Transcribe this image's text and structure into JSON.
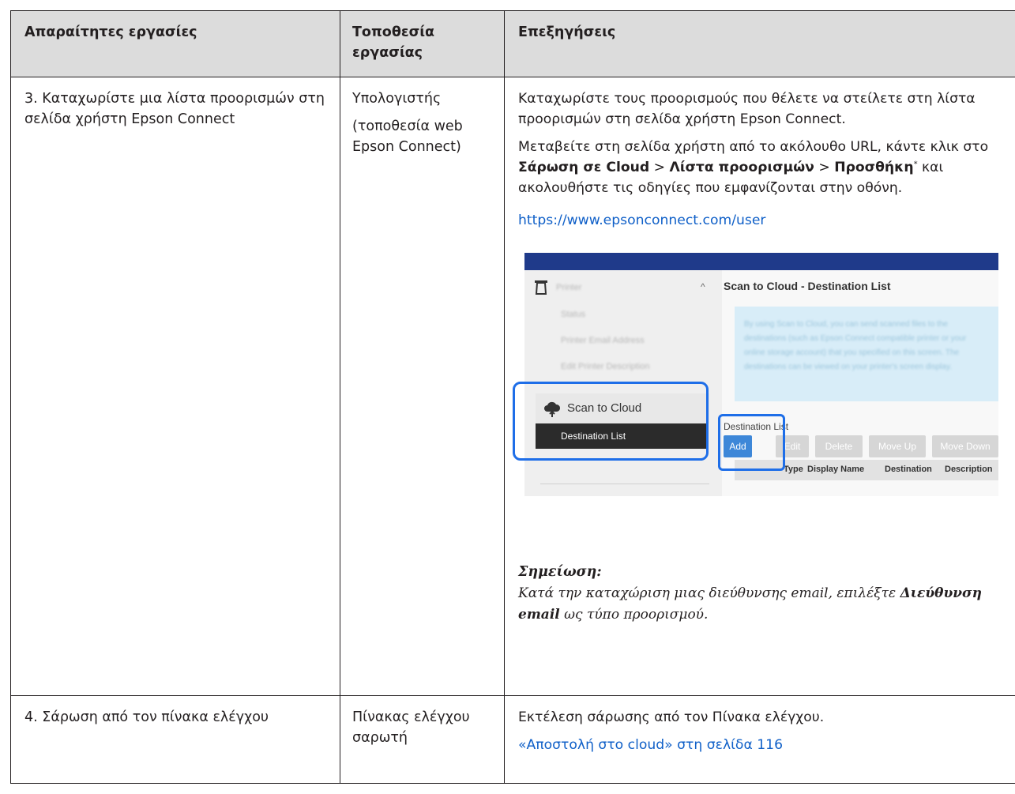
{
  "headers": {
    "tasks": "Απαραίτητες εργασίες",
    "location": "Τοποθεσία εργασίας",
    "explanation": "Επεξηγήσεις"
  },
  "row3": {
    "task": "3. Καταχωρίστε μια λίστα προορισμών στη σελίδα χρήστη Epson Connect",
    "location_line1": "Υπολογιστής",
    "location_line2": "(τοποθεσία web Epson Connect)",
    "para1": "Καταχωρίστε τους προορισμούς που θέλετε να στείλετε στη λίστα προορισμών στη σελίδα χρήστη Epson Connect.",
    "para2_start": "Μεταβείτε στη σελίδα χρήστη από το ακόλουθο URL, κάντε κλικ στο ",
    "para2_bold1": "Σάρωση σε Cloud",
    "para2_sep1": " > ",
    "para2_bold2": "Λίστα προορισμών",
    "para2_sep2": " > ",
    "para2_bold3": "Προσθήκη",
    "para2_sup": "*",
    "para2_end": " και ακολουθήστε τις οδηγίες που εμφανίζονται στην οθόνη.",
    "url": "https://www.epsonconnect.com/user",
    "note_title": "Σημείωση:",
    "note_text_start": "Κατά την καταχώριση μιας διεύθυνσης email, επιλέξτε ",
    "note_text_bold": "Διεύθυνση email",
    "note_text_end": " ως τύπο προορισμού."
  },
  "screenshot": {
    "printer_label": "Printer",
    "status": "Status",
    "printer_email": "Printer Email Address",
    "edit_desc": "Edit Printer Description",
    "scan_to_cloud": "Scan to Cloud",
    "destination_list": "Destination List",
    "title": "Scan to Cloud - Destination List",
    "info_text": "By using Scan to Cloud, you can send scanned files to the destinations (such as Epson Connect compatible printer or your online storage account) that you specified on this screen. The destinations can be viewed on your printer's screen display.",
    "dest_list_label": "Destination List",
    "btn_add": "Add",
    "btn_edit": "Edit",
    "btn_delete": "Delete",
    "btn_move_up": "Move Up",
    "btn_move_down": "Move Down",
    "col_type": "Type",
    "col_display_name": "Display Name",
    "col_destination": "Destination",
    "col_description": "Description"
  },
  "row4": {
    "task": "4. Σάρωση από τον πίνακα ελέγχου",
    "location": "Πίνακας ελέγχου σαρωτή",
    "para": "Εκτέλεση σάρωσης από τον Πίνακα ελέγχου.",
    "link": "«Αποστολή στο cloud» στη σελίδα 116"
  }
}
